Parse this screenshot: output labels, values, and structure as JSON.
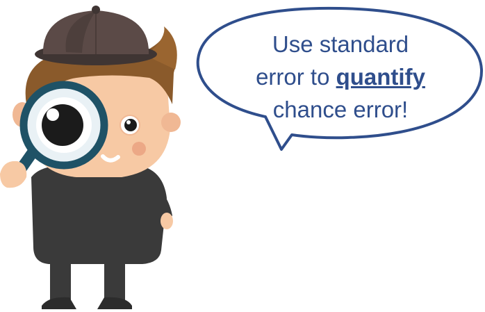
{
  "speech_bubble": {
    "line1": "Use standard",
    "line2_before": "error to ",
    "line2_emphasis": "quantify",
    "line3": "chance error!"
  },
  "illustration": {
    "character": "detective-with-magnifying-glass",
    "colors": {
      "hat": "#5b4a47",
      "hair": "#8a5a2b",
      "skin": "#f7c9a4",
      "coat": "#3a3a3a",
      "lens_ring": "#1f5266",
      "bubble_border": "#2f4e8c",
      "text": "#2f4e8c"
    }
  }
}
